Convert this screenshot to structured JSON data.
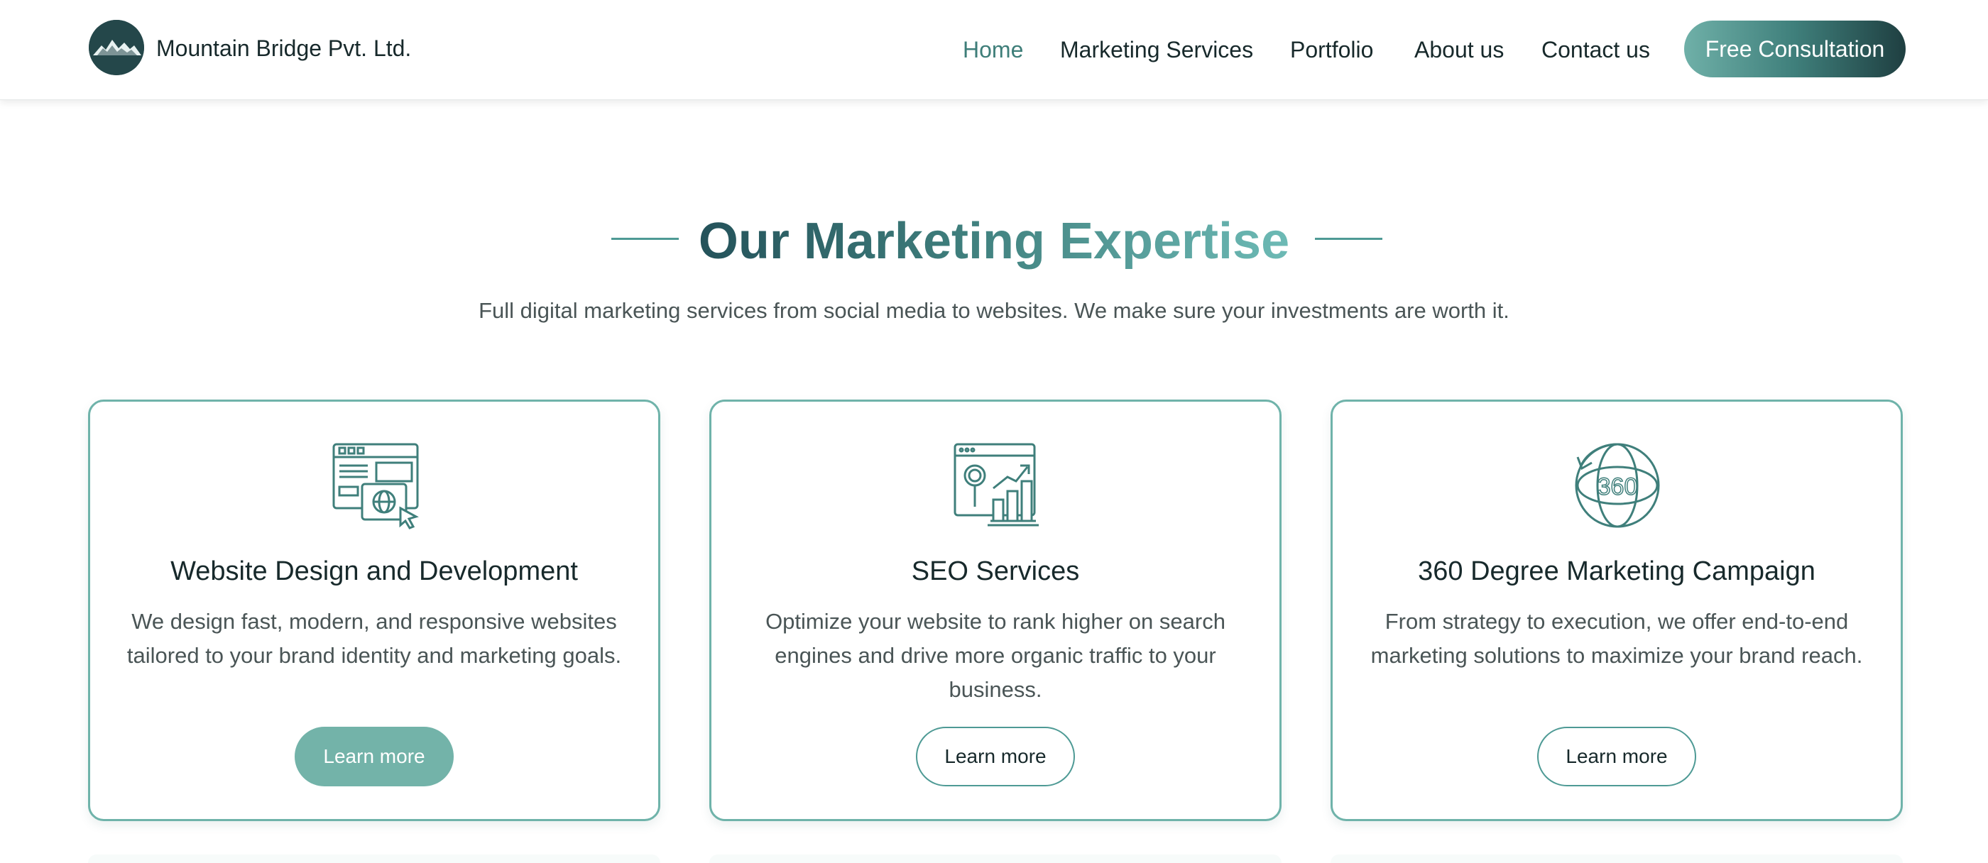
{
  "colors": {
    "accent": "#4e9a95",
    "accent_light": "#73b3a9",
    "dark": "#24474a",
    "text": "#17292b",
    "muted": "#4a5556"
  },
  "header": {
    "logo_icon": "mountain-logo-icon",
    "brand": "Mountain Bridge Pvt. Ltd.",
    "nav": [
      {
        "label": "Home",
        "active": true
      },
      {
        "label": "Marketing Services",
        "active": false
      },
      {
        "label": "Portfolio",
        "active": false
      },
      {
        "label": "About us",
        "active": false
      },
      {
        "label": "Contact us",
        "active": false
      }
    ],
    "cta": "Free Consultation"
  },
  "section": {
    "title": "Our Marketing Expertise",
    "subtitle": "Full digital marketing services from social media to websites. We make sure your investments are worth it."
  },
  "cards": [
    {
      "icon": "website-design-icon",
      "title": "Website Design and Development",
      "description": "We design fast, modern, and responsive websites tailored to your brand identity and marketing goals.",
      "button": "Learn more",
      "button_style": "filled"
    },
    {
      "icon": "seo-analytics-icon",
      "title": "SEO Services",
      "description": "Optimize your website to rank higher on search engines and drive more organic traffic to your business.",
      "button": "Learn more",
      "button_style": "outline"
    },
    {
      "icon": "globe-360-icon",
      "title": "360 Degree Marketing Campaign",
      "description": "From strategy to execution, we offer end-to-end marketing solutions to maximize your brand reach.",
      "button": "Learn more",
      "button_style": "outline"
    }
  ]
}
